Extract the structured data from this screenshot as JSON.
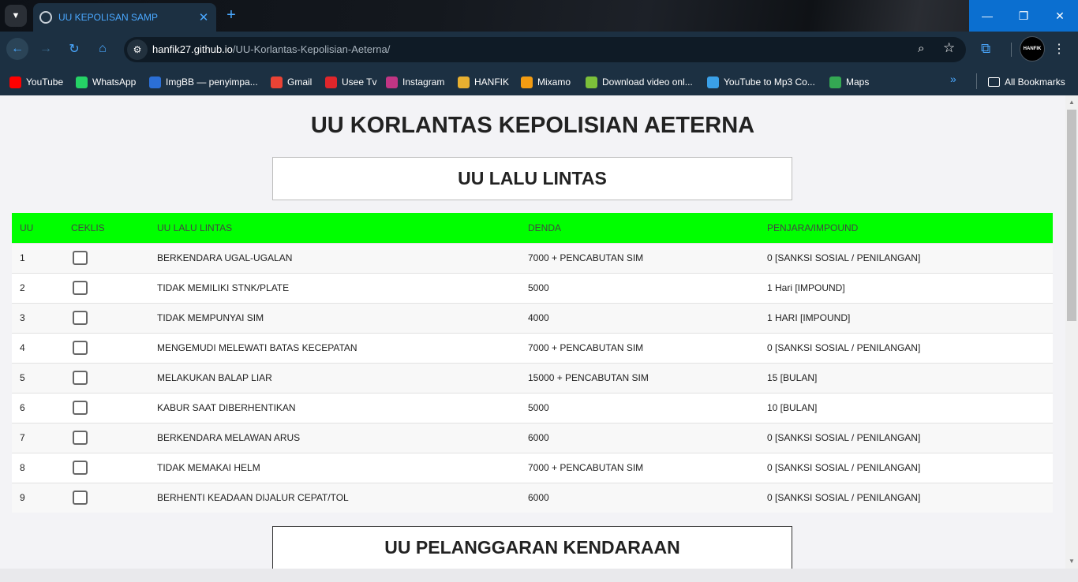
{
  "browser": {
    "tab_title": "UU KEPOLISAN SAMP",
    "url_host": "hanfik27.github.io",
    "url_path": "/UU-Korlantas-Kepolisian-Aeterna/",
    "avatar_label": "HANFIK",
    "bookmarks": [
      {
        "label": "YouTube",
        "icon": "youtube-icon",
        "color": "#ff0000"
      },
      {
        "label": "WhatsApp",
        "icon": "whatsapp-icon",
        "color": "#25d366"
      },
      {
        "label": "ImgBB — penyimpa...",
        "icon": "imgbb-icon",
        "color": "#2b6fd6"
      },
      {
        "label": "Gmail",
        "icon": "gmail-icon",
        "color": "#ea4335"
      },
      {
        "label": "Usee Tv",
        "icon": "useetv-icon",
        "color": "#e0262b"
      },
      {
        "label": "Instagram",
        "icon": "instagram-icon",
        "color": "#c13584"
      },
      {
        "label": "HANFIK",
        "icon": "hanfik-icon",
        "color": "#e8b030"
      },
      {
        "label": "Mixamo",
        "icon": "mixamo-icon",
        "color": "#f39c12"
      },
      {
        "label": "Download video onl...",
        "icon": "download-icon",
        "color": "#7cc03a"
      },
      {
        "label": "YouTube to Mp3 Co...",
        "icon": "mp3-icon",
        "color": "#3aa0e8"
      },
      {
        "label": "Maps",
        "icon": "maps-icon",
        "color": "#34a853"
      }
    ],
    "all_bookmarks": "All Bookmarks"
  },
  "page": {
    "title": "UU KORLANTAS KEPOLISIAN AETERNA",
    "section1": "UU LALU LINTAS",
    "section2": "UU PELANGGARAN KENDARAAN",
    "table_header_color": "#00ff00",
    "columns": [
      "UU",
      "CEKLIS",
      "UU LALU LINTAS",
      "DENDA",
      "PENJARA/IMPOUND"
    ],
    "rows": [
      {
        "no": "1",
        "uu": "BERKENDARA UGAL-UGALAN",
        "denda": "7000 + PENCABUTAN SIM",
        "penjara": "0 [SANKSI SOSIAL / PENILANGAN]"
      },
      {
        "no": "2",
        "uu": "TIDAK MEMILIKI STNK/PLATE",
        "denda": "5000",
        "penjara": "1 Hari [IMPOUND]"
      },
      {
        "no": "3",
        "uu": "TIDAK MEMPUNYAI SIM",
        "denda": "4000",
        "penjara": "1 HARI [IMPOUND]"
      },
      {
        "no": "4",
        "uu": "MENGEMUDI MELEWATI BATAS KECEPATAN",
        "denda": "7000 + PENCABUTAN SIM",
        "penjara": "0 [SANKSI SOSIAL / PENILANGAN]"
      },
      {
        "no": "5",
        "uu": "MELAKUKAN BALAP LIAR",
        "denda": "15000 + PENCABUTAN SIM",
        "penjara": "15 [BULAN]"
      },
      {
        "no": "6",
        "uu": "KABUR SAAT DIBERHENTIKAN",
        "denda": "5000",
        "penjara": "10 [BULAN]"
      },
      {
        "no": "7",
        "uu": "BERKENDARA MELAWAN ARUS",
        "denda": "6000",
        "penjara": "0 [SANKSI SOSIAL / PENILANGAN]"
      },
      {
        "no": "8",
        "uu": "TIDAK MEMAKAI HELM",
        "denda": "7000 + PENCABUTAN SIM",
        "penjara": "0 [SANKSI SOSIAL / PENILANGAN]"
      },
      {
        "no": "9",
        "uu": "BERHENTI KEADAAN DIJALUR CEPAT/TOL",
        "denda": "6000",
        "penjara": "0 [SANKSI SOSIAL / PENILANGAN]"
      }
    ]
  }
}
